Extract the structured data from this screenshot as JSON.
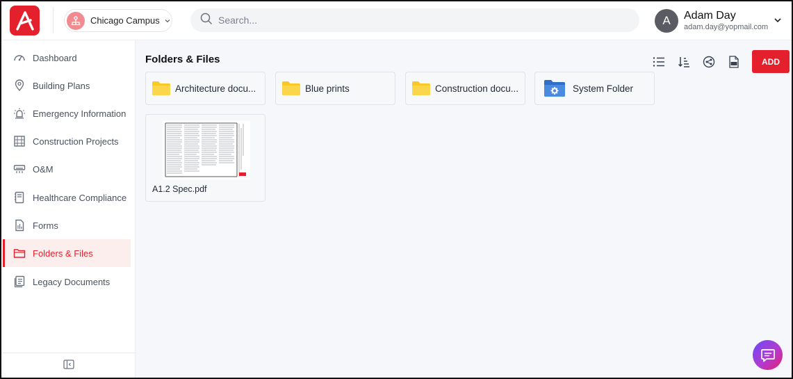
{
  "header": {
    "campus_label": "Chicago Campus",
    "search_placeholder": "Search...",
    "user": {
      "initial": "A",
      "name": "Adam Day",
      "email": "adam.day@yopmail.com"
    }
  },
  "sidebar": {
    "items": [
      {
        "label": "Dashboard",
        "icon": "gauge-icon"
      },
      {
        "label": "Building Plans",
        "icon": "map-pin-icon"
      },
      {
        "label": "Emergency Information",
        "icon": "alarm-light-icon"
      },
      {
        "label": "Construction Projects",
        "icon": "building-icon"
      },
      {
        "label": "O&M",
        "icon": "air-conditioner-icon"
      },
      {
        "label": "Healthcare Compliance",
        "icon": "notebook-icon"
      },
      {
        "label": "Forms",
        "icon": "form-document-icon"
      },
      {
        "label": "Folders & Files",
        "icon": "folder-icon",
        "active": true
      },
      {
        "label": "Legacy Documents",
        "icon": "documents-stack-icon"
      }
    ]
  },
  "main": {
    "title": "Folders & Files",
    "add_label": "ADD",
    "folders": [
      {
        "name": "Architecture docu...",
        "type": "folder"
      },
      {
        "name": "Blue prints",
        "type": "folder"
      },
      {
        "name": "Construction docu...",
        "type": "folder"
      },
      {
        "name": "System Folder",
        "type": "system-folder"
      }
    ],
    "files": [
      {
        "name": "A1.2 Spec.pdf"
      }
    ]
  },
  "colors": {
    "brand_red": "#e4202c",
    "folder_yellow": "#f9c928",
    "system_folder_blue": "#3b7dd8",
    "active_bg": "#fdeeee"
  }
}
